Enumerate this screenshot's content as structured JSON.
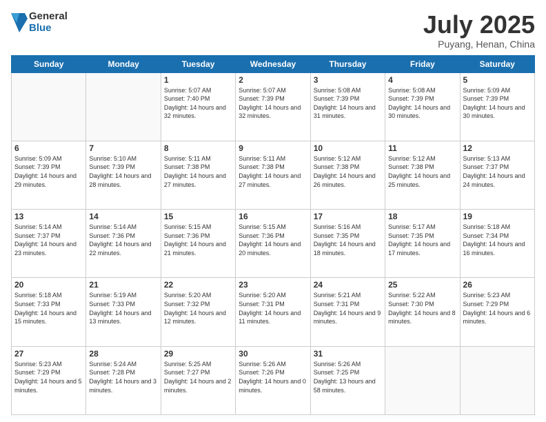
{
  "logo": {
    "general": "General",
    "blue": "Blue"
  },
  "header": {
    "month": "July 2025",
    "location": "Puyang, Henan, China"
  },
  "weekdays": [
    "Sunday",
    "Monday",
    "Tuesday",
    "Wednesday",
    "Thursday",
    "Friday",
    "Saturday"
  ],
  "weeks": [
    [
      {
        "day": null
      },
      {
        "day": null
      },
      {
        "day": 1,
        "sunrise": "5:07 AM",
        "sunset": "7:40 PM",
        "daylight": "14 hours and 32 minutes."
      },
      {
        "day": 2,
        "sunrise": "5:07 AM",
        "sunset": "7:39 PM",
        "daylight": "14 hours and 32 minutes."
      },
      {
        "day": 3,
        "sunrise": "5:08 AM",
        "sunset": "7:39 PM",
        "daylight": "14 hours and 31 minutes."
      },
      {
        "day": 4,
        "sunrise": "5:08 AM",
        "sunset": "7:39 PM",
        "daylight": "14 hours and 30 minutes."
      },
      {
        "day": 5,
        "sunrise": "5:09 AM",
        "sunset": "7:39 PM",
        "daylight": "14 hours and 30 minutes."
      }
    ],
    [
      {
        "day": 6,
        "sunrise": "5:09 AM",
        "sunset": "7:39 PM",
        "daylight": "14 hours and 29 minutes."
      },
      {
        "day": 7,
        "sunrise": "5:10 AM",
        "sunset": "7:39 PM",
        "daylight": "14 hours and 28 minutes."
      },
      {
        "day": 8,
        "sunrise": "5:11 AM",
        "sunset": "7:38 PM",
        "daylight": "14 hours and 27 minutes."
      },
      {
        "day": 9,
        "sunrise": "5:11 AM",
        "sunset": "7:38 PM",
        "daylight": "14 hours and 27 minutes."
      },
      {
        "day": 10,
        "sunrise": "5:12 AM",
        "sunset": "7:38 PM",
        "daylight": "14 hours and 26 minutes."
      },
      {
        "day": 11,
        "sunrise": "5:12 AM",
        "sunset": "7:38 PM",
        "daylight": "14 hours and 25 minutes."
      },
      {
        "day": 12,
        "sunrise": "5:13 AM",
        "sunset": "7:37 PM",
        "daylight": "14 hours and 24 minutes."
      }
    ],
    [
      {
        "day": 13,
        "sunrise": "5:14 AM",
        "sunset": "7:37 PM",
        "daylight": "14 hours and 23 minutes."
      },
      {
        "day": 14,
        "sunrise": "5:14 AM",
        "sunset": "7:36 PM",
        "daylight": "14 hours and 22 minutes."
      },
      {
        "day": 15,
        "sunrise": "5:15 AM",
        "sunset": "7:36 PM",
        "daylight": "14 hours and 21 minutes."
      },
      {
        "day": 16,
        "sunrise": "5:15 AM",
        "sunset": "7:36 PM",
        "daylight": "14 hours and 20 minutes."
      },
      {
        "day": 17,
        "sunrise": "5:16 AM",
        "sunset": "7:35 PM",
        "daylight": "14 hours and 18 minutes."
      },
      {
        "day": 18,
        "sunrise": "5:17 AM",
        "sunset": "7:35 PM",
        "daylight": "14 hours and 17 minutes."
      },
      {
        "day": 19,
        "sunrise": "5:18 AM",
        "sunset": "7:34 PM",
        "daylight": "14 hours and 16 minutes."
      }
    ],
    [
      {
        "day": 20,
        "sunrise": "5:18 AM",
        "sunset": "7:33 PM",
        "daylight": "14 hours and 15 minutes."
      },
      {
        "day": 21,
        "sunrise": "5:19 AM",
        "sunset": "7:33 PM",
        "daylight": "14 hours and 13 minutes."
      },
      {
        "day": 22,
        "sunrise": "5:20 AM",
        "sunset": "7:32 PM",
        "daylight": "14 hours and 12 minutes."
      },
      {
        "day": 23,
        "sunrise": "5:20 AM",
        "sunset": "7:31 PM",
        "daylight": "14 hours and 11 minutes."
      },
      {
        "day": 24,
        "sunrise": "5:21 AM",
        "sunset": "7:31 PM",
        "daylight": "14 hours and 9 minutes."
      },
      {
        "day": 25,
        "sunrise": "5:22 AM",
        "sunset": "7:30 PM",
        "daylight": "14 hours and 8 minutes."
      },
      {
        "day": 26,
        "sunrise": "5:23 AM",
        "sunset": "7:29 PM",
        "daylight": "14 hours and 6 minutes."
      }
    ],
    [
      {
        "day": 27,
        "sunrise": "5:23 AM",
        "sunset": "7:29 PM",
        "daylight": "14 hours and 5 minutes."
      },
      {
        "day": 28,
        "sunrise": "5:24 AM",
        "sunset": "7:28 PM",
        "daylight": "14 hours and 3 minutes."
      },
      {
        "day": 29,
        "sunrise": "5:25 AM",
        "sunset": "7:27 PM",
        "daylight": "14 hours and 2 minutes."
      },
      {
        "day": 30,
        "sunrise": "5:26 AM",
        "sunset": "7:26 PM",
        "daylight": "14 hours and 0 minutes."
      },
      {
        "day": 31,
        "sunrise": "5:26 AM",
        "sunset": "7:25 PM",
        "daylight": "13 hours and 58 minutes."
      },
      {
        "day": null
      },
      {
        "day": null
      }
    ]
  ]
}
